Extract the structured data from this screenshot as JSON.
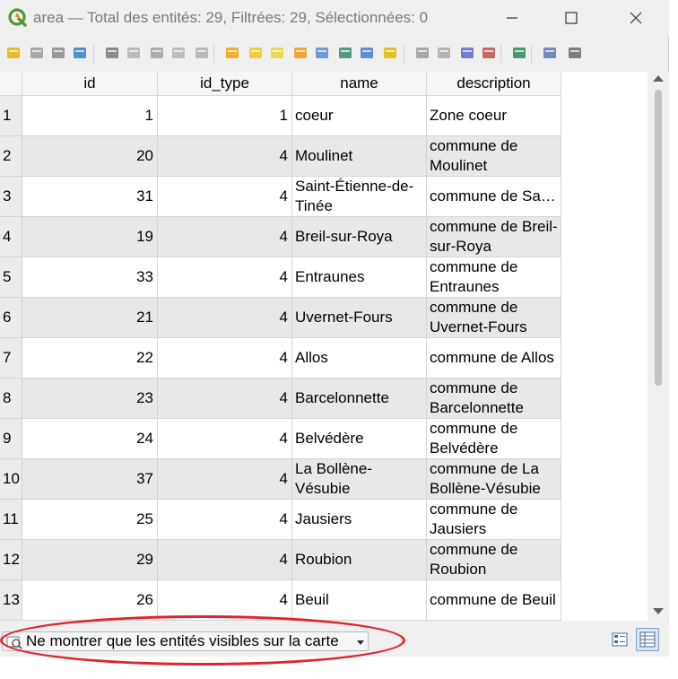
{
  "window": {
    "title": "area — Total des entités: 29, Filtrées: 29, Sélectionnées: 0"
  },
  "toolbar": {
    "icons": [
      "toggle-editing-icon",
      "multi-edit-icon",
      "save-edits-icon",
      "reload-icon",
      "add-feature-icon",
      "delete-feature-icon",
      "cut-icon",
      "copy-icon",
      "paste-icon",
      "select-by-expression-icon",
      "select-all-icon",
      "invert-selection-icon",
      "deselect-icon",
      "filter-select-icon",
      "move-selection-top-icon",
      "pan-to-selection-icon",
      "zoom-to-selection-icon",
      "new-field-icon",
      "delete-field-icon",
      "field-calculator-icon",
      "conditional-formatting-icon",
      "dock-icon",
      "actions-icon",
      "organize-columns-icon"
    ]
  },
  "table": {
    "columns": [
      "id",
      "id_type",
      "name",
      "description"
    ],
    "rows": [
      {
        "num": "1",
        "id": "1",
        "id_type": "1",
        "name": "coeur",
        "description": "Zone coeur"
      },
      {
        "num": "2",
        "id": "20",
        "id_type": "4",
        "name": "Moulinet",
        "description": "commune de Moulinet"
      },
      {
        "num": "3",
        "id": "31",
        "id_type": "4",
        "name": "Saint-Étienne-de-Tinée",
        "description": "commune de Sa…"
      },
      {
        "num": "4",
        "id": "19",
        "id_type": "4",
        "name": "Breil-sur-Roya",
        "description": "commune de Breil-sur-Roya"
      },
      {
        "num": "5",
        "id": "33",
        "id_type": "4",
        "name": "Entraunes",
        "description": "commune de Entraunes"
      },
      {
        "num": "6",
        "id": "21",
        "id_type": "4",
        "name": "Uvernet-Fours",
        "description": "commune de Uvernet-Fours"
      },
      {
        "num": "7",
        "id": "22",
        "id_type": "4",
        "name": "Allos",
        "description": "commune de Allos"
      },
      {
        "num": "8",
        "id": "23",
        "id_type": "4",
        "name": "Barcelonnette",
        "description": "commune de Barcelonnette"
      },
      {
        "num": "9",
        "id": "24",
        "id_type": "4",
        "name": "Belvédère",
        "description": "commune de Belvédère"
      },
      {
        "num": "10",
        "id": "37",
        "id_type": "4",
        "name": "La Bollène-Vésubie",
        "description": "commune de La Bollène-Vésubie"
      },
      {
        "num": "11",
        "id": "25",
        "id_type": "4",
        "name": "Jausiers",
        "description": "commune de Jausiers"
      },
      {
        "num": "12",
        "id": "29",
        "id_type": "4",
        "name": "Roubion",
        "description": "commune de Roubion"
      },
      {
        "num": "13",
        "id": "26",
        "id_type": "4",
        "name": "Beuil",
        "description": "commune de Beuil"
      }
    ]
  },
  "statusbar": {
    "filter_label": "Ne montrer que les entités visibles sur la carte"
  },
  "colors": {
    "highlight_ellipse": "#e0242a",
    "alt_row": "#e9e8e6"
  }
}
